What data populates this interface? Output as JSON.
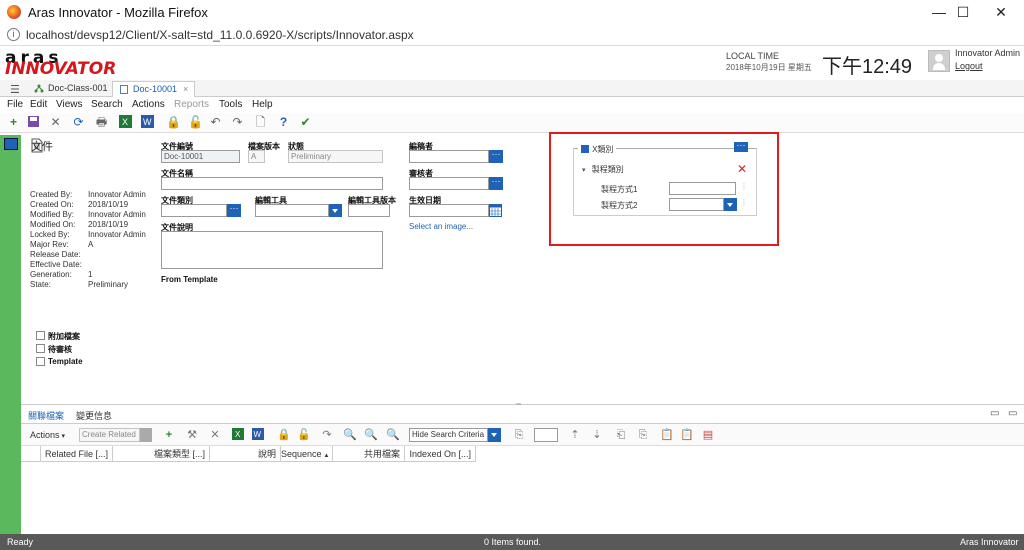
{
  "browser": {
    "title": "Aras Innovator - Mozilla Firefox",
    "url": "localhost/devsp12/Client/X-salt=std_11.0.0.6920-X/scripts/Innovator.aspx",
    "minimize": "—",
    "maximize": "☐",
    "close": "✕"
  },
  "header": {
    "logo_top": "aras",
    "logo_bottom": "INNOVATOR",
    "local_time_label": "LOCAL TIME",
    "date": "2018年10月19日 星期五",
    "clock": "下午12:49",
    "user": "Innovator Admin",
    "logout": "Logout"
  },
  "tabs": [
    {
      "label": "Doc-Class-001",
      "active": false
    },
    {
      "label": "Doc-10001",
      "active": true
    }
  ],
  "menu": {
    "file": "File",
    "edit": "Edit",
    "views": "Views",
    "search": "Search",
    "actions": "Actions",
    "reports": "Reports",
    "tools": "Tools",
    "help": "Help"
  },
  "form": {
    "title": "文件",
    "meta": [
      {
        "label": "Created By:",
        "value": "Innovator Admin"
      },
      {
        "label": "Created On:",
        "value": "2018/10/19"
      },
      {
        "label": "Modified By:",
        "value": "Innovator Admin"
      },
      {
        "label": "Modified On:",
        "value": "2018/10/19"
      },
      {
        "label": "Locked By:",
        "value": "Innovator Admin"
      },
      {
        "label": "Major Rev:",
        "value": "A"
      },
      {
        "label": "Release Date:",
        "value": ""
      },
      {
        "label": "Effective Date:",
        "value": ""
      },
      {
        "label": "Generation:",
        "value": "1"
      },
      {
        "label": "State:",
        "value": "Preliminary"
      }
    ],
    "doc_no_label": "文件編號",
    "doc_no_value": "Doc-10001",
    "rev_label": "檔案版本",
    "rev_value": "A",
    "state_label": "狀態",
    "state_value": "Preliminary",
    "name_label": "文件名稱",
    "class_label": "文件類別",
    "tool_label": "編輯工具",
    "tool_ver_label": "編輯工具版本",
    "desc_label": "文件說明",
    "from_template": "From Template",
    "editor_label": "編稿者",
    "reviewer_label": "審核者",
    "effective_label": "生效日期",
    "select_image": "Select an image...",
    "checkboxes": [
      "附加檔案",
      "待審核",
      "Template"
    ]
  },
  "xclass": {
    "title": "X類別",
    "group": "製程類別",
    "field1_label": "製程方式1",
    "field2_label": "製程方式2"
  },
  "relationships": {
    "tabs": [
      "關聯檔案",
      "變更信息"
    ],
    "actions": "Actions",
    "create_related": "Create Related",
    "hide_search": "Hide Search Criteria",
    "columns": [
      "Related File [...]",
      "檔案類型 [...]",
      "說明",
      "Sequence",
      "共用檔案",
      "Indexed On [...]"
    ]
  },
  "status": {
    "left": "Ready",
    "center": "0 Items found.",
    "right": "Aras Innovator"
  }
}
